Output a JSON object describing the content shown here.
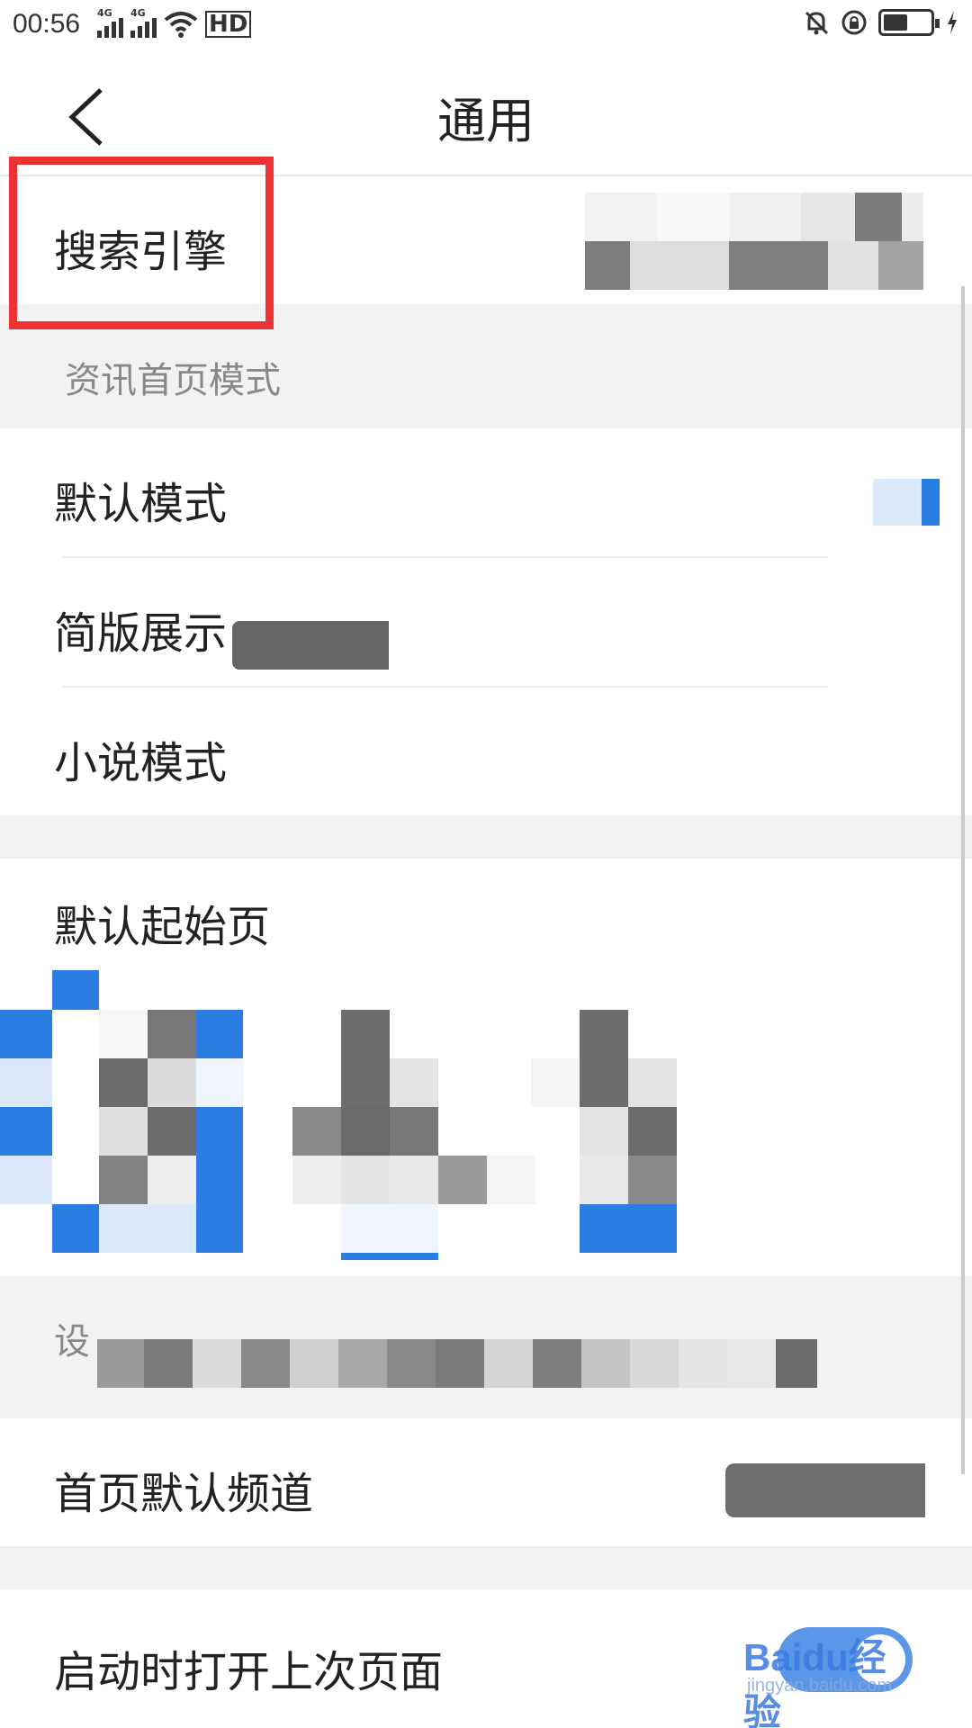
{
  "status_bar": {
    "time": "00:56",
    "sim1_label": "4G",
    "sim2_label": "4G",
    "hd_label": "HD"
  },
  "header": {
    "title": "通用"
  },
  "rows": {
    "search_engine": "搜索引擎",
    "news_home_mode_section": "资讯首页模式",
    "default_mode": "默认模式",
    "simple_display": "简版展示",
    "novel_mode": "小说模式",
    "default_start_page": "默认起始页",
    "home_default_channel": "首页默认频道",
    "open_last_page_on_start": "启动时打开上次页面"
  },
  "blurred_section_label": "设",
  "watermark": {
    "text": "Baidu经验",
    "sub": "jingyan.baidu.com"
  },
  "colors": {
    "highlight": "#ec3232",
    "accent": "#2a7de1"
  }
}
